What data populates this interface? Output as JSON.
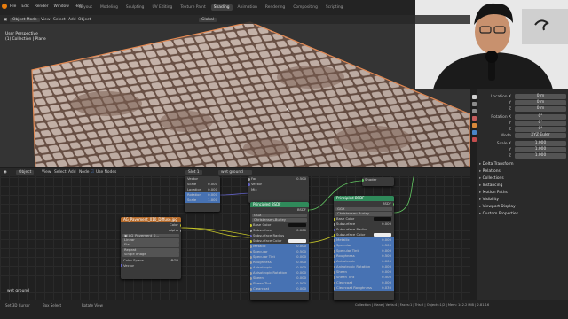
{
  "topbar": {
    "menus": [
      "File",
      "Edit",
      "Render",
      "Window",
      "Help"
    ],
    "tabs": [
      "Layout",
      "Modeling",
      "Sculpting",
      "UV Editing",
      "Texture Paint",
      "Shading",
      "Animation",
      "Rendering",
      "Compositing",
      "Scripting"
    ],
    "active_tab": "Shading"
  },
  "viewport": {
    "mode": "Object Mode",
    "menus": [
      "View",
      "Select",
      "Add",
      "Object"
    ],
    "shading": "Global",
    "info_line1": "User Perspective",
    "info_line2": "(1) Collection | Plane"
  },
  "props": {
    "loc_label": "Location X",
    "loc": [
      "0 m",
      "0 m",
      "0 m"
    ],
    "rot_label": "Rotation X",
    "rot": [
      "0°",
      "0°",
      "0°"
    ],
    "mode_label": "Mode",
    "mode": "XYZ Euler",
    "scale_label": "Scale X",
    "scale": [
      "1.000",
      "1.000",
      "1.000"
    ],
    "axis": [
      "Y",
      "Z"
    ],
    "sections": [
      "Delta Transform",
      "Relations",
      "Collections",
      "Instancing",
      "Motion Paths",
      "Visibility",
      "Viewport Display",
      "Custom Properties"
    ]
  },
  "node_editor": {
    "type": "Object",
    "menus": [
      "View",
      "Select",
      "Add",
      "Node"
    ],
    "use_nodes": "Use Nodes",
    "slot": "Slot 1",
    "material": "wet ground",
    "corner_label": "wet ground"
  },
  "image_node": {
    "title": "AG_Pavement_010_Diffuse.jpg",
    "out_color": "Color",
    "out_alpha": "Alpha",
    "image": "AG_Pavement_0...",
    "interp": "Linear",
    "proj": "Flat",
    "ext": "Repeat",
    "src": "Single Image",
    "cs_label": "Color Space",
    "cs": "sRGB",
    "vector": "Vector"
  },
  "bsdf1": {
    "title": "Principled BSDF",
    "bsdf": "BSDF",
    "dist": "GGX",
    "ss_method": "Christensen-Burley",
    "rows": [
      [
        "Base Color",
        ""
      ],
      [
        "Subsurface",
        "0.000"
      ],
      [
        "Subsurface Radius",
        ""
      ],
      [
        "Subsurface Color",
        ""
      ],
      [
        "Metallic",
        "0.000"
      ],
      [
        "Specular",
        "0.500"
      ],
      [
        "Specular Tint",
        "0.000"
      ],
      [
        "Roughness",
        "0.500"
      ],
      [
        "Anisotropic",
        "0.000"
      ],
      [
        "Anisotropic Rotation",
        "0.000"
      ],
      [
        "Sheen",
        "0.000"
      ],
      [
        "Sheen Tint",
        "0.500"
      ],
      [
        "Clearcoat",
        "0.000"
      ]
    ]
  },
  "bsdf2": {
    "title": "Principled BSDF",
    "bsdf": "BSDF",
    "dist": "GGX",
    "ss_method": "Christensen-Burley",
    "rows": [
      [
        "Base Color",
        ""
      ],
      [
        "Subsurface",
        "0.000"
      ],
      [
        "Subsurface Radius",
        ""
      ],
      [
        "Subsurface Color",
        ""
      ],
      [
        "Metallic",
        "0.000"
      ],
      [
        "Specular",
        "0.500"
      ],
      [
        "Specular Tint",
        "0.000"
      ],
      [
        "Roughness",
        "0.500"
      ],
      [
        "Anisotropic",
        "0.000"
      ],
      [
        "Anisotropic Rotation",
        "0.000"
      ],
      [
        "Sheen",
        "0.000"
      ],
      [
        "Sheen Tint",
        "0.500"
      ],
      [
        "Clearcoat",
        "0.000"
      ],
      [
        "Clearcoat Roughness",
        "0.030"
      ]
    ]
  },
  "mix_node": {
    "fac": "Fac",
    "vector": "Vector",
    "val": "0.500",
    "color1": "Mix",
    "out": "Shader"
  },
  "mapping_node": {
    "r1": "Vector",
    "r2": "Scale",
    "r3": "Location",
    "r4": "Rotation",
    "r5": "Scale",
    "vals": [
      "0.000",
      "0.000",
      "0.000",
      "1.000"
    ]
  },
  "status": {
    "items": [
      "Set 3D Cursor",
      "Box Select",
      "Rotate View",
      "Collection | Plane | Verts:4 | Faces:1 | Tris:2 | Objects:1/2 | Mem: 142.2 MiB | 2.81.16"
    ]
  },
  "colors": {
    "accent": "#4772b3",
    "bsdf_header": "#2f8a5a",
    "image_header": "#b46a2b",
    "socket_yellow": "#c7c729",
    "socket_grey": "#a1a1a1",
    "socket_green": "#63c763",
    "socket_purple": "#6363c7"
  }
}
